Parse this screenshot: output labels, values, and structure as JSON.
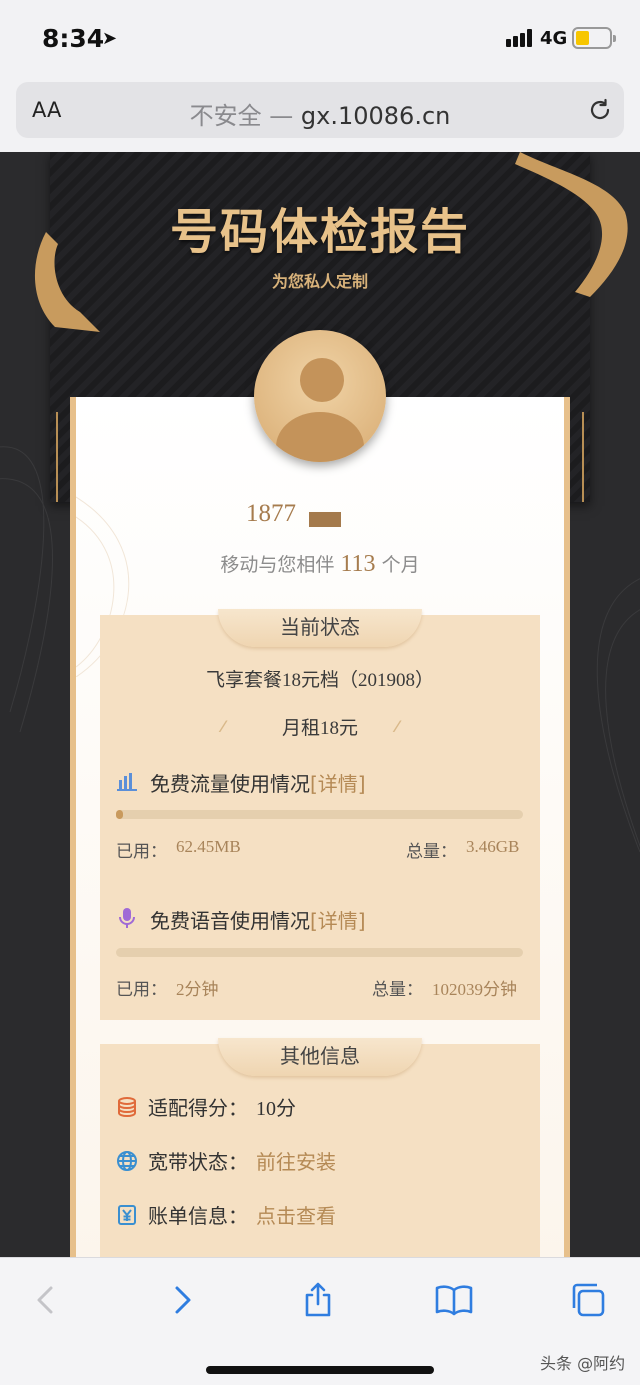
{
  "status_bar": {
    "time": "8:34",
    "network": "4G",
    "battery_level": 0.35
  },
  "browser": {
    "text_size_button": "AA",
    "insecure_label": "不安全 — ",
    "domain": "gx.10086.cn"
  },
  "banner": {
    "title": "号码体检报告",
    "subtitle": "为您私人定制"
  },
  "profile": {
    "phone_prefix": "1877",
    "months_prefix": "移动与您相伴 ",
    "months_value": "113",
    "months_suffix": " 个月"
  },
  "status_section": {
    "tab_label": "当前状态",
    "plan_name": "飞享套餐18元档（201908）",
    "monthly_rent": "月租18元",
    "data_usage": {
      "title": "免费流量使用情况",
      "detail_link": "[详情]",
      "used_label": "已用：",
      "used_value": "62.45MB",
      "total_label": "总量：",
      "total_value": "3.46GB",
      "progress": 0.018
    },
    "voice_usage": {
      "title": "免费语音使用情况",
      "detail_link": "[详情]",
      "used_label": "已用：",
      "used_value": "2分钟",
      "total_label": "总量：",
      "total_value": "102039分钟",
      "progress": 0.0
    }
  },
  "other_section": {
    "tab_label": "其他信息",
    "rows": [
      {
        "label": "适配得分：",
        "value": "10分",
        "icon": "coin-stack-icon"
      },
      {
        "label": "宽带状态：",
        "value": "前往安装",
        "icon": "globe-icon"
      },
      {
        "label": "账单信息：",
        "value": "点击查看",
        "icon": "bill-icon"
      }
    ]
  },
  "toolbar": {
    "icons": [
      "back-icon",
      "forward-icon",
      "share-icon",
      "bookmarks-icon",
      "tabs-icon"
    ]
  },
  "watermark": "头条 @阿约",
  "colors": {
    "gold": "#b58a55",
    "section_bg": "#f5e0c3",
    "banner_title": "#e8c28a"
  }
}
